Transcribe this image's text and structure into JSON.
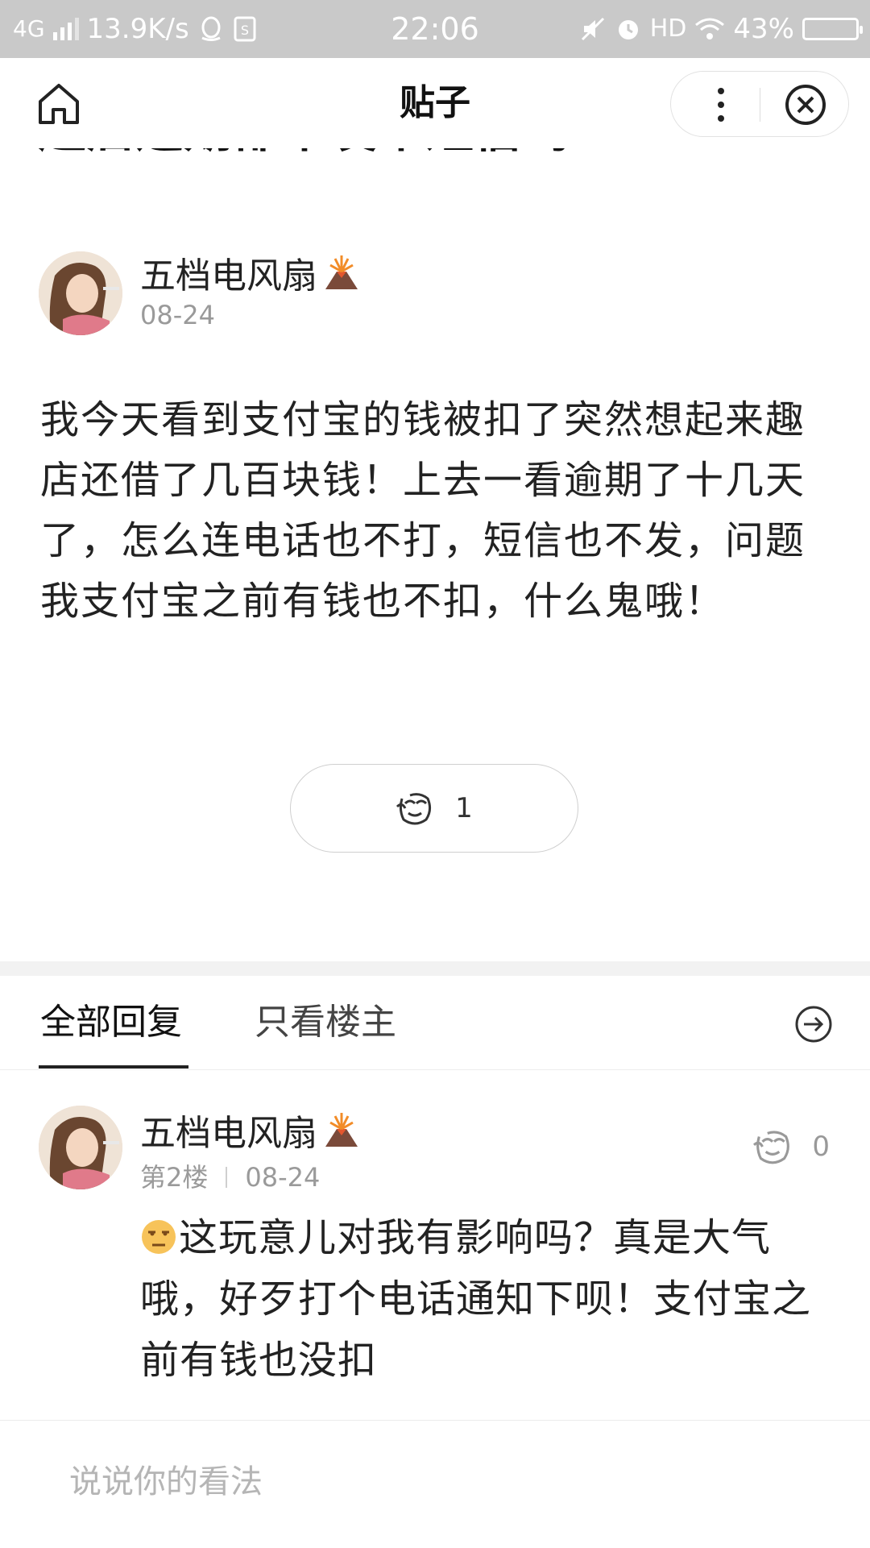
{
  "status_bar": {
    "network": "4G",
    "speed": "13.9K/s",
    "time": "22:06",
    "hd": "HD",
    "battery": "43%"
  },
  "nav": {
    "title": "贴子"
  },
  "post": {
    "title_partial": "趣店逾期都不发个短信吗？",
    "author": "五档电风扇",
    "date": "08-24",
    "body": "我今天看到支付宝的钱被扣了突然想起来趣店还借了几百块钱！上去一看逾期了十几天了，怎么连电话也不打，短信也不发，问题我支付宝之前有钱也不扣，什么鬼哦！",
    "like_count": "1"
  },
  "tabs": {
    "all": "全部回复",
    "op_only": "只看楼主"
  },
  "reply": {
    "author": "五档电风扇",
    "floor": "第2楼",
    "date": "08-24",
    "like_count": "0",
    "text": "这玩意儿对我有影响吗？真是大气哦，好歹打个电话通知下呗！支付宝之前有钱也没扣"
  },
  "comment_box": {
    "placeholder": "说说你的看法"
  },
  "icons": [
    "home-icon",
    "more-icon",
    "close-icon",
    "qq-icon",
    "sim-icon",
    "mute-icon",
    "alarm-icon",
    "wifi-icon",
    "battery-icon",
    "volcano-badge-icon",
    "like-icon",
    "arrow-right-icon",
    "unamused-emoji-icon"
  ]
}
